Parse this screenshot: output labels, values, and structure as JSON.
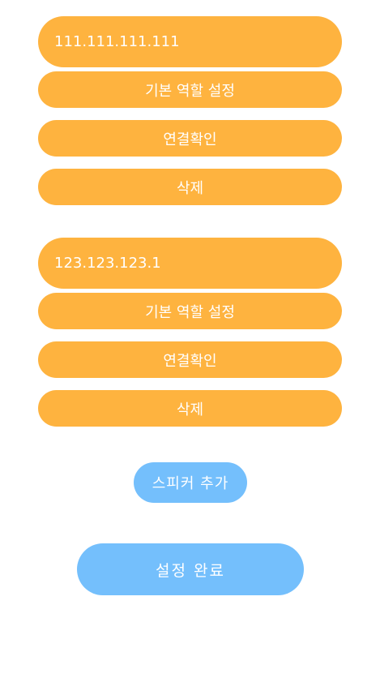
{
  "speakers": [
    {
      "ip": "111.111.111.111",
      "default_role_label": "기본 역할 설정",
      "connection_check_label": "연결확인",
      "delete_label": "삭제"
    },
    {
      "ip": "123.123.123.1",
      "default_role_label": "기본 역할 설정",
      "connection_check_label": "연결확인",
      "delete_label": "삭제"
    }
  ],
  "add_speaker_label": "스피커 추가",
  "finish_label": "설정 완료",
  "colors": {
    "orange": "#FEB33F",
    "blue": "#74BFFC",
    "text": "#FFFFFF",
    "background": "#FFFFFF"
  }
}
